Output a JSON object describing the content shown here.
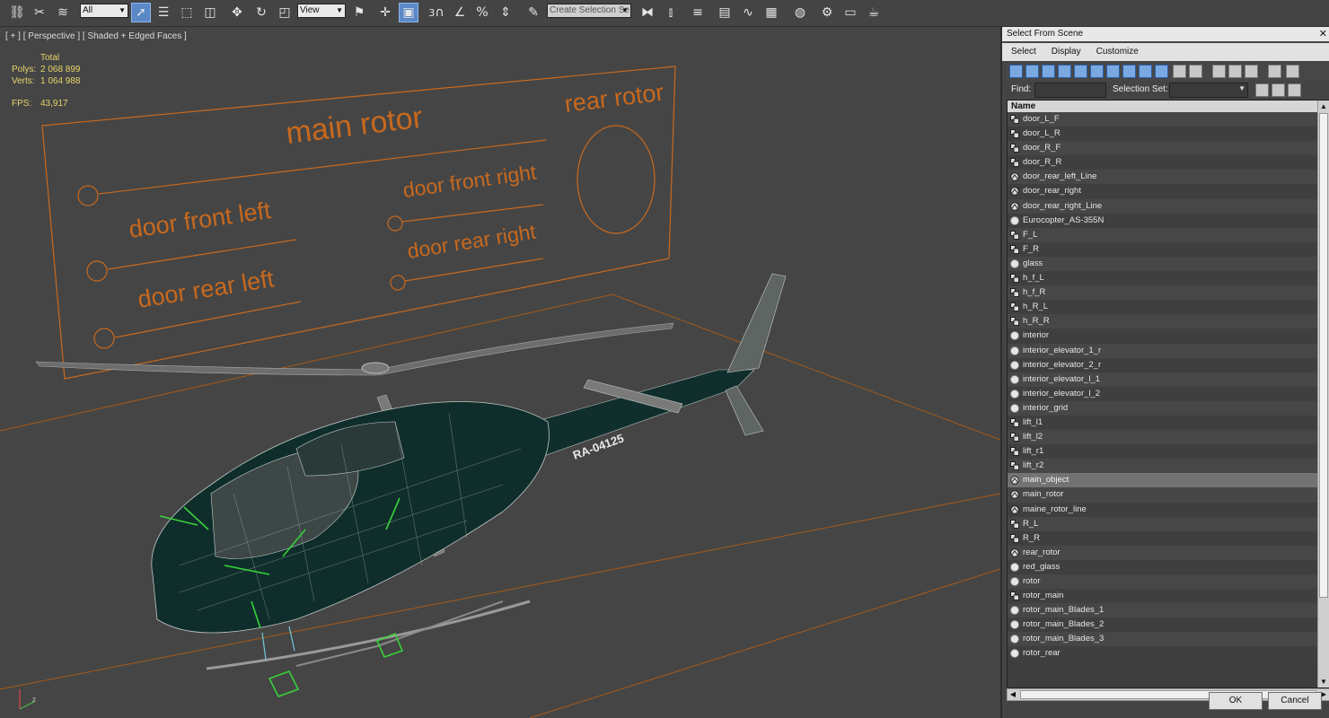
{
  "toolbar": {
    "filter_value": "All",
    "coord_value": "View",
    "selection_set_placeholder": "Create Selection Se",
    "icons": [
      "link-icon",
      "unlink-icon",
      "bind-spacewarp-icon",
      "select-object-icon",
      "select-by-name-icon",
      "rect-region-icon",
      "window-crossing-icon",
      "move-icon",
      "rotate-icon",
      "scale-icon",
      "pivot-icon",
      "snap-3d-icon",
      "angle-snap-icon",
      "percent-snap-icon",
      "spinner-snap-icon",
      "edit-named-sets-icon",
      "mirror-icon",
      "align-icon",
      "layer-icon",
      "graphite-icon",
      "curve-editor-icon",
      "schematic-icon",
      "material-editor-icon",
      "render-setup-icon",
      "render-frame-icon",
      "render-icon"
    ],
    "snap_label": "3"
  },
  "viewport": {
    "label": "[ + ] [ Perspective ] [ Shaded + Edged Faces ]",
    "stats": {
      "total_label": "Total",
      "polys_label": "Polys:",
      "polys_value": "2 068 899",
      "verts_label": "Verts:",
      "verts_value": "1 064 988",
      "fps_label": "FPS:",
      "fps_value": "43,917"
    },
    "board_labels": {
      "main_rotor": "main rotor",
      "rear_rotor": "rear rotor",
      "door_front_left": "door front left",
      "door_front_right": "door front right",
      "door_rear_left": "door rear left",
      "door_rear_right": "door rear right"
    },
    "registration": "RA-04125",
    "colors": {
      "background": "#454545",
      "board": "#c8691e",
      "grid": "#a85a1a",
      "hull": "#0f2e2b",
      "wire": "#bfc7c5",
      "accent": "#38d23a"
    }
  },
  "panel": {
    "title": "Select From Scene",
    "close": "✕",
    "menu": [
      "Select",
      "Display",
      "Customize"
    ],
    "find_label": "Find:",
    "find_value": "",
    "selection_set_label": "Selection Set:",
    "selection_set_value": "",
    "column_header": "Name",
    "rows": [
      {
        "name": "door_L_F",
        "icon": "group-icon"
      },
      {
        "name": "door_L_R",
        "icon": "group-icon"
      },
      {
        "name": "door_R_F",
        "icon": "group-icon"
      },
      {
        "name": "door_R_R",
        "icon": "group-icon"
      },
      {
        "name": "door_rear_left_Line",
        "icon": "shape-icon"
      },
      {
        "name": "door_rear_right",
        "icon": "shape-icon"
      },
      {
        "name": "door_rear_right_Line",
        "icon": "shape-icon"
      },
      {
        "name": "Eurocopter_AS-355N",
        "icon": "geometry-icon"
      },
      {
        "name": "F_L",
        "icon": "group-icon"
      },
      {
        "name": "F_R",
        "icon": "group-icon"
      },
      {
        "name": "glass",
        "icon": "geometry-icon"
      },
      {
        "name": "h_f_L",
        "icon": "group-icon"
      },
      {
        "name": "h_f_R",
        "icon": "group-icon"
      },
      {
        "name": "h_R_L",
        "icon": "group-icon"
      },
      {
        "name": "h_R_R",
        "icon": "group-icon"
      },
      {
        "name": "interior",
        "icon": "geometry-icon"
      },
      {
        "name": "interior_elevator_1_r",
        "icon": "geometry-icon"
      },
      {
        "name": "interior_elevator_2_r",
        "icon": "geometry-icon"
      },
      {
        "name": "interior_elevator_l_1",
        "icon": "geometry-icon"
      },
      {
        "name": "interior_elevator_l_2",
        "icon": "geometry-icon"
      },
      {
        "name": "interior_grid",
        "icon": "geometry-icon"
      },
      {
        "name": "lift_l1",
        "icon": "group-icon"
      },
      {
        "name": "lift_l2",
        "icon": "group-icon"
      },
      {
        "name": "lift_r1",
        "icon": "group-icon"
      },
      {
        "name": "lift_r2",
        "icon": "group-icon"
      },
      {
        "name": "main_object",
        "icon": "shape-icon",
        "selected": true
      },
      {
        "name": "main_rotor",
        "icon": "shape-icon"
      },
      {
        "name": "maine_rotor_line",
        "icon": "shape-icon"
      },
      {
        "name": "R_L",
        "icon": "group-icon"
      },
      {
        "name": "R_R",
        "icon": "group-icon"
      },
      {
        "name": "rear_rotor",
        "icon": "shape-icon"
      },
      {
        "name": "red_glass",
        "icon": "geometry-icon"
      },
      {
        "name": "rotor",
        "icon": "geometry-icon"
      },
      {
        "name": "rotor_main",
        "icon": "group-icon"
      },
      {
        "name": "rotor_main_Blades_1",
        "icon": "geometry-icon"
      },
      {
        "name": "rotor_main_Blades_2",
        "icon": "geometry-icon"
      },
      {
        "name": "rotor_main_Blades_3",
        "icon": "geometry-icon"
      },
      {
        "name": "rotor_rear",
        "icon": "geometry-icon"
      }
    ],
    "ok_label": "OK",
    "cancel_label": "Cancel"
  }
}
